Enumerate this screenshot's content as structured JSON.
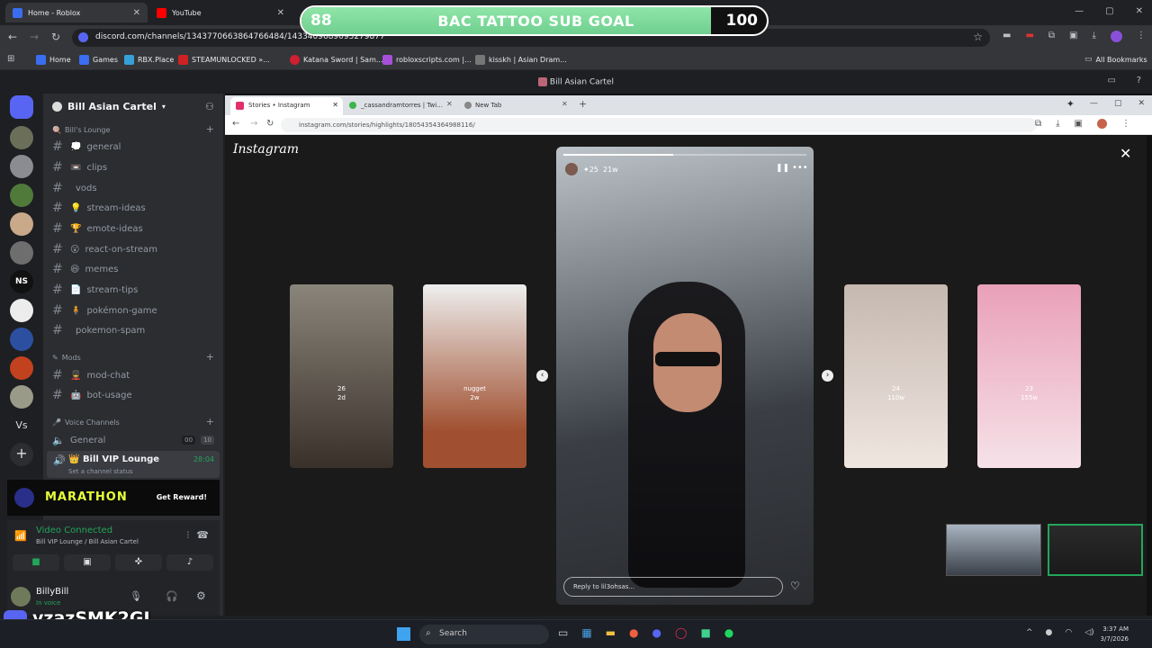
{
  "chrome": {
    "tabs": [
      {
        "label": "Home - Roblox"
      },
      {
        "label": "YouTube"
      }
    ],
    "url": "discord.com/channels/1343770663864766484/1433409689095279877",
    "bookmarks": [
      "Home",
      "Games",
      "RBX.Place",
      "STEAMUNLOCKED »...",
      "Katana Sword | Sam...",
      "robloxscripts.com |...",
      "kisskh | Asian Dram..."
    ],
    "all_bookmarks": "All Bookmarks"
  },
  "goal": {
    "current": "88",
    "title": "BAC TATTOO SUB GOAL",
    "target": "100",
    "progress": 0.88
  },
  "discord": {
    "window_title": "Bill Asian Cartel",
    "server_name": "Bill Asian Cartel",
    "categories": {
      "lounge": "Bill's Lounge",
      "mods": "Mods",
      "voice": "Voice Channels"
    },
    "channels": [
      {
        "emoji": "💭",
        "name": "general"
      },
      {
        "emoji": "📼",
        "name": "clips"
      },
      {
        "emoji": "",
        "name": "vods"
      },
      {
        "emoji": "💡",
        "name": "stream-ideas"
      },
      {
        "emoji": "🏆",
        "name": "emote-ideas"
      },
      {
        "emoji": "😮",
        "name": "react-on-stream"
      },
      {
        "emoji": "😆",
        "name": "memes"
      },
      {
        "emoji": "📄",
        "name": "stream-tips"
      },
      {
        "emoji": "🧍",
        "name": "pokémon-game"
      },
      {
        "emoji": "",
        "name": "pokemon-spam"
      }
    ],
    "mod_channels": [
      {
        "emoji": "💂",
        "name": "mod-chat"
      },
      {
        "emoji": "🤖",
        "name": "bot-usage"
      }
    ],
    "voice_channels": [
      {
        "name": "General",
        "badge1": "00",
        "badge2": "10"
      },
      {
        "name": "Bill VIP Lounge",
        "time": "28:04",
        "status": "Set a channel status"
      }
    ],
    "promo": {
      "title": "MARATHON",
      "cta": "Get Reward!"
    },
    "voice": {
      "status": "Video Connected",
      "location": "Bill VIP Lounge / Bill Asian Cartel"
    },
    "user": {
      "name": "BillyBill",
      "status": "In voice"
    },
    "watermark": "vzazSMK2GJ"
  },
  "inner": {
    "tabs": [
      "Stories • Instagram",
      "_cassandramtorres | Twitter, Inc",
      "New Tab"
    ],
    "url": "instagram.com/stories/highlights/18054354364988116/",
    "brand": "Instagram",
    "main_story": {
      "likes": "25",
      "age": "21w",
      "reply_placeholder": "Reply to lil3ohsas..."
    },
    "side_stories": [
      {
        "likes": "26",
        "age": "2d"
      },
      {
        "caption": "nugget",
        "age": "2w"
      },
      {
        "likes": "24",
        "age": "110w"
      },
      {
        "likes": "23",
        "age": "155w"
      }
    ]
  },
  "taskbar": {
    "search": "Search",
    "time": "3:37 AM",
    "date": "3/7/2026"
  }
}
